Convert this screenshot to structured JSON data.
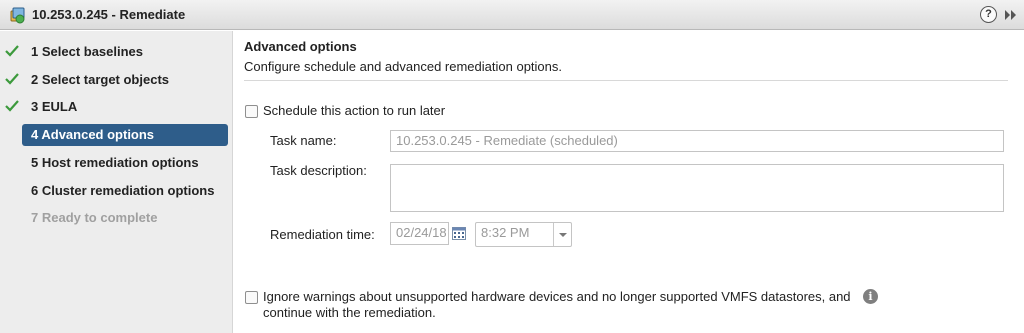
{
  "window": {
    "title": "10.253.0.245 - Remediate",
    "help_glyph": "?",
    "app_icon": "wizard-icon",
    "expand_icon": "double-chevron-right-icon"
  },
  "steps": [
    {
      "label": "1  Select baselines",
      "state": "done"
    },
    {
      "label": "2  Select target objects",
      "state": "done"
    },
    {
      "label": "3  EULA",
      "state": "done"
    },
    {
      "label": "4  Advanced options",
      "state": "active"
    },
    {
      "label": "5  Host remediation options",
      "state": "pending"
    },
    {
      "label": "6  Cluster remediation options",
      "state": "pending"
    },
    {
      "label": "7  Ready to complete",
      "state": "disabled"
    }
  ],
  "main": {
    "title": "Advanced options",
    "subtitle": "Configure schedule and advanced remediation options.",
    "schedule_label": "Schedule this action to run later",
    "task_name_label": "Task name:",
    "task_name_value": "10.253.0.245 - Remediate (scheduled)",
    "task_desc_label": "Task description:",
    "task_desc_value": "",
    "remediation_time_label": "Remediation time:",
    "date_value": "02/24/18",
    "time_value": "8:32 PM",
    "ignore_label_line1": "Ignore warnings about unsupported hardware devices and no longer supported VMFS datastores, and",
    "ignore_label_line2": "continue with the remediation.",
    "info_glyph": "i"
  },
  "colors": {
    "active_step_bg": "#2e5d8a",
    "check_green": "#3c9a3c",
    "sidebar_bg": "#ededed"
  }
}
